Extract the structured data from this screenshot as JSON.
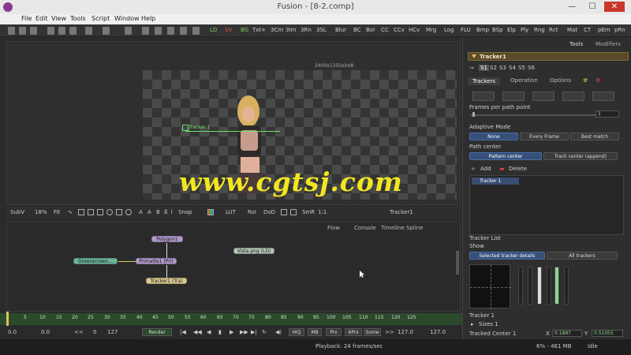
{
  "window": {
    "title": "Fusion - [8-2.comp]",
    "min": "—",
    "max": "☐",
    "close": "✕"
  },
  "menu": [
    "File",
    "Edit",
    "View",
    "Tools",
    "Script",
    "Window",
    "Help"
  ],
  "toolbar": {
    "green_tools": [
      "LD",
      "BG"
    ],
    "red_tools": [
      "SV"
    ],
    "tools": [
      "Txt+",
      "3Cm",
      "3Im",
      "3Rn",
      "3SL",
      "Blur",
      "BC",
      "Bol",
      "CC",
      "CCv",
      "HCv",
      "Mrg",
      "Log",
      "FLU",
      "Bmp",
      "BSp",
      "Elp",
      "Ply",
      "Rng",
      "Rct",
      "Mat",
      "CT",
      "pEm",
      "pRn"
    ]
  },
  "viewer": {
    "resolution": "2400x1350xint8",
    "tracker_label": "Tracker 1",
    "watermark": "www.cgtsj.com",
    "toolbar": {
      "subv": "SubV",
      "zoom": "18%",
      "fit": "Fit",
      "snap": "Snap",
      "lut": "LUT",
      "roi": "RoI",
      "dod": "DoD",
      "smr": "SmR",
      "ratio": "1:1",
      "node_name": "Tracker1"
    }
  },
  "flow": {
    "tabs": [
      "Flow",
      "Console",
      "Timeline",
      "Spline"
    ],
    "nodes": {
      "polygon": "Polygon1",
      "greenscreen": "Greenscreen...",
      "primatte": "Primatte1 (Pri)",
      "tracker": "Tracker1 (Tra)",
      "vista": "Vista.png (LD)"
    }
  },
  "timeline": {
    "ticks": [
      "5",
      "10",
      "15",
      "20",
      "25",
      "30",
      "35",
      "40",
      "45",
      "50",
      "55",
      "60",
      "65",
      "70",
      "75",
      "80",
      "85",
      "90",
      "95",
      "100",
      "105",
      "110",
      "115",
      "120",
      "125"
    ]
  },
  "transport": {
    "start": "0.0",
    "start2": "0.0",
    "range_start": "0",
    "range_end": "127",
    "render": "Render",
    "hiq": "HiQ",
    "mb": "MB",
    "prx": "Prx",
    "aprx": "APrx",
    "some": "Some",
    "end1": "127.0",
    "end2": "127.0"
  },
  "status": {
    "playback": "Playback: 24 frames/sec",
    "memory": "6% - 461 MB",
    "state": "Idle"
  },
  "inspector": {
    "tabs_top": [
      "Tools",
      "Modifiers"
    ],
    "tool_name": "Tracker1",
    "slots": [
      "S1",
      "S2",
      "S3",
      "S4",
      "S5",
      "S6"
    ],
    "sub_tabs": [
      "Trackers",
      "Operation",
      "Options"
    ],
    "fpp_label": "Frames per path point",
    "fpp_value": "1",
    "adaptive_label": "Adaptive Mode",
    "adaptive": [
      "None",
      "Every Frame",
      "Best match"
    ],
    "path_center_label": "Path center",
    "path_center": [
      "Pattern center",
      "Track center (append)"
    ],
    "add": "Add",
    "delete": "Delete",
    "tracker_item": "Tracker 1",
    "tracker_list_label": "Tracker List",
    "show_label": "Show",
    "show_opts": [
      "Selected tracker details",
      "All trackers"
    ],
    "tracker_name": "Tracker 1",
    "sizes": "Sizes 1",
    "tracked_center": "Tracked Center 1",
    "x_label": "X",
    "x_val": "0.1887",
    "y_label": "Y",
    "y_val": "0.51055"
  },
  "colors": {
    "accent": "#35507a",
    "node_header": "#5a4a2a",
    "tracker_green": "#6be26b",
    "watermark": "#f2e620",
    "timeline": "#2b4a2b"
  }
}
